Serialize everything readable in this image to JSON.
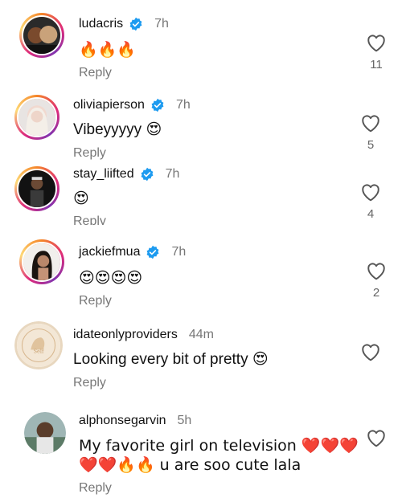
{
  "comments": [
    {
      "username": "ludacris",
      "verified": true,
      "time": "7h",
      "text": "🔥🔥🔥",
      "reply": "Reply",
      "likes": "11"
    },
    {
      "username": "oliviapierson",
      "verified": true,
      "time": "7h",
      "text": "Vibeyyyyy 😍",
      "reply": "Reply",
      "likes": "5"
    },
    {
      "username": "stay_liifted",
      "verified": true,
      "time": "7h",
      "text": "😍",
      "reply": "Reply",
      "likes": "4"
    },
    {
      "username": "jackiefmua",
      "verified": true,
      "time": "7h",
      "text": "😍😍😍😍",
      "reply": "Reply",
      "likes": "2"
    },
    {
      "username": "idateonlyproviders",
      "verified": false,
      "time": "44m",
      "text": "Looking every bit of pretty 😍",
      "reply": "Reply",
      "likes": ""
    },
    {
      "username": "alphonsegarvin",
      "verified": false,
      "time": "5h",
      "text_line1": "My favorite girl on television ❤️❤️❤️",
      "text_line2": "❤️❤️🔥🔥 u are soo cute lala",
      "reply": "Reply",
      "likes": ""
    }
  ],
  "colors": {
    "verified": "#1d9bf0",
    "muted": "#777777",
    "heart_outline": "#555555"
  },
  "icons": {
    "verified": "verified-badge-icon",
    "like": "heart-outline-icon"
  }
}
